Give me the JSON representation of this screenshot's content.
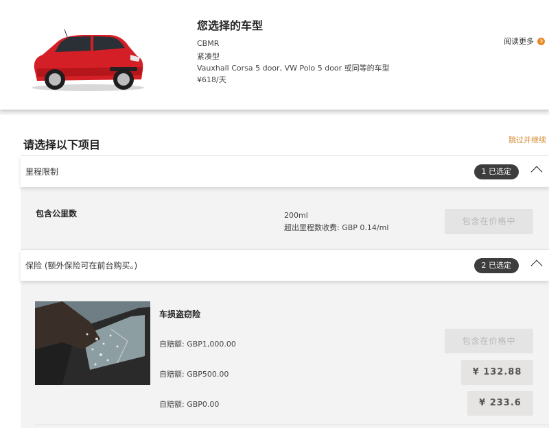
{
  "vehicle": {
    "title": "您选择的车型",
    "code": "CBMR",
    "category": "紧凑型",
    "models": "Vauxhall Corsa 5 door, VW Polo 5 door 或同等的车型",
    "price": "¥618/天",
    "read_more": "阅读更多"
  },
  "options": {
    "heading": "请选择以下项目",
    "skip_label": "跳过并继续",
    "mileage_group": {
      "title": "里程限制",
      "badge": "1 已选定",
      "item_name": "包含公里数",
      "limit": "200ml",
      "excess_fee": "超出里程数收费: GBP 0.14/ml",
      "button": "包含在价格中"
    },
    "insurance_group": {
      "title": "保险 (额外保险可在前台购买。)",
      "badge": "2 已选定",
      "item_name": "车损盗窃险",
      "tiers": [
        {
          "excess": "自赔额: GBP1,000.00",
          "button": "包含在价格中"
        },
        {
          "excess": "自赔额: GBP500.00",
          "button": "¥ 132.88"
        },
        {
          "excess": "自赔额: GBP0.00",
          "button": "¥ 233.6"
        }
      ]
    }
  },
  "colors": {
    "accent_orange": "#e8892a",
    "badge_dark": "#3d3d3d",
    "car_red": "#d41f26"
  }
}
